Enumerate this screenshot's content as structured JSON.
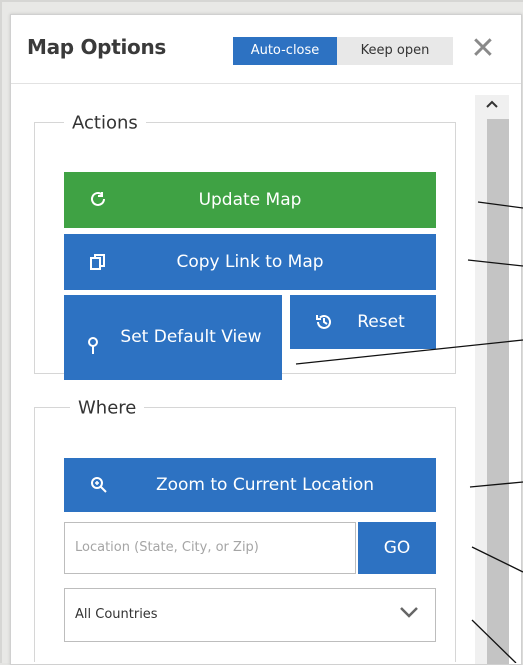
{
  "panel": {
    "title": "Map Options",
    "mode_toggle": {
      "auto_close": "Auto-close",
      "keep_open": "Keep open"
    }
  },
  "actions": {
    "legend": "Actions",
    "update_map": "Update Map",
    "copy_link": "Copy Link to Map",
    "set_default_view": "Set Default View",
    "reset": "Reset"
  },
  "where": {
    "legend": "Where",
    "zoom_current": "Zoom to Current Location",
    "location_placeholder": "Location (State, City, or Zip)",
    "go": "GO",
    "country_selected": "All Countries"
  },
  "colors": {
    "primary": "#2d72c2",
    "success": "#3fa244"
  },
  "icons": {
    "update": "refresh-icon",
    "copy": "copy-icon",
    "pin": "map-pin-icon",
    "reset": "history-icon",
    "zoom": "zoom-in-icon",
    "close": "close-icon",
    "dropdown": "chevron-down-icon",
    "scroll": "scroll-up-icon"
  }
}
